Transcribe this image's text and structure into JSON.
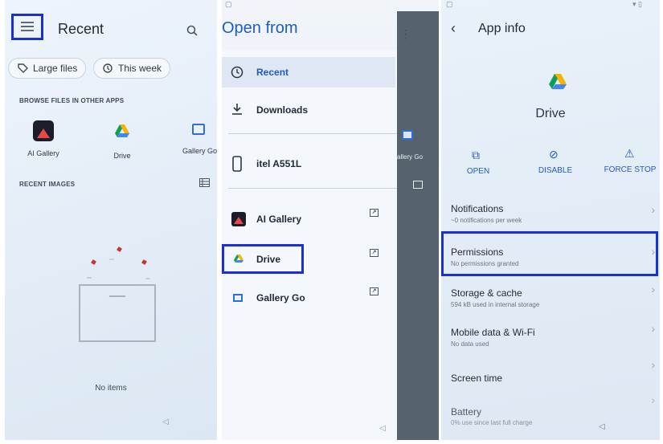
{
  "panel1": {
    "title": "Recent",
    "chips": [
      {
        "label": "Large files",
        "icon": "tag-icon"
      },
      {
        "label": "This week",
        "icon": "history-icon"
      }
    ],
    "browse_header": "BROWSE FILES IN OTHER APPS",
    "apps": [
      {
        "label": "AI Gallery",
        "icon": "ai-gallery-icon"
      },
      {
        "label": "Drive",
        "icon": "drive-icon"
      },
      {
        "label": "Gallery Go",
        "icon": "gallery-go-icon"
      }
    ],
    "recent_images_header": "RECENT IMAGES",
    "empty_text": "No items"
  },
  "panel2": {
    "title": "Open from",
    "items": [
      {
        "label": "Recent",
        "icon": "clock-icon"
      },
      {
        "label": "Downloads",
        "icon": "download-icon"
      },
      {
        "label": "itel A551L",
        "icon": "phone-icon"
      },
      {
        "label": "AI Gallery",
        "icon": "ai-gallery-icon"
      },
      {
        "label": "Drive",
        "icon": "drive-icon"
      },
      {
        "label": "Gallery Go",
        "icon": "gallery-go-icon"
      }
    ],
    "behind_label": "allery Go"
  },
  "panel3": {
    "title": "App info",
    "app_name": "Drive",
    "actions": [
      {
        "label": "OPEN",
        "icon": "open-external-icon"
      },
      {
        "label": "DISABLE",
        "icon": "block-icon"
      },
      {
        "label": "FORCE STOP",
        "icon": "warning-icon"
      }
    ],
    "rows": [
      {
        "title": "Notifications",
        "subtitle": "~0 notifications per week"
      },
      {
        "title": "Permissions",
        "subtitle": "No permissions granted"
      },
      {
        "title": "Storage & cache",
        "subtitle": "594 kB used in internal storage"
      },
      {
        "title": "Mobile data & Wi-Fi",
        "subtitle": "No data used"
      },
      {
        "title": "Screen time",
        "subtitle": ""
      },
      {
        "title": "Battery",
        "subtitle": "0% use since last full charge"
      }
    ]
  },
  "colors": {
    "highlight": "#1b2fd6",
    "accent": "#1f5bc7"
  }
}
